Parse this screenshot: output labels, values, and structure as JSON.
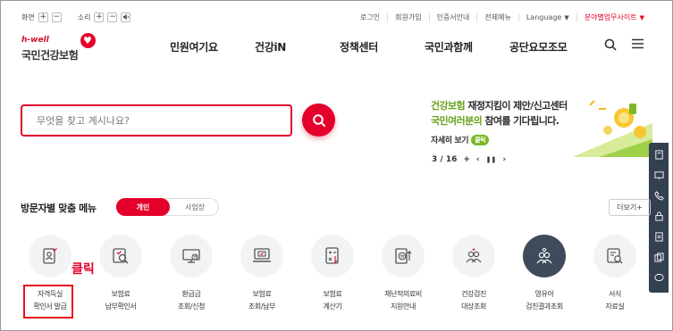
{
  "utility": {
    "screen_label": "화면",
    "sound_label": "소리",
    "plus": "+",
    "minus": "−",
    "links": [
      "로그인",
      "회원가입",
      "인증서안내",
      "전체메뉴"
    ],
    "language": "Language",
    "subsite": "분야별업무사이트"
  },
  "logo": {
    "sub": "h-well",
    "main": "국민건강보험"
  },
  "gnb": [
    "민원여기요",
    "건강iN",
    "정책센터",
    "국민과함께",
    "공단요모조모"
  ],
  "search": {
    "placeholder": "무엇을 찾고 계시나요?",
    "value": ""
  },
  "banner": {
    "line1_green": "건강보험",
    "line1_dark": "재정지킴이 제안/신고센터",
    "line2_green": "국민여러분의",
    "line2_dark": "참여를 기다립니다.",
    "more": "자세히 보기",
    "more_badge": "클릭",
    "pager": "3 / 16",
    "plus": "+",
    "prev": "‹",
    "pause": "❚❚",
    "next": "›"
  },
  "section": {
    "title": "방문자별 맞춤 메뉴",
    "tab_on": "개인",
    "tab_off": "사업장",
    "more": "더보기+"
  },
  "menu": [
    {
      "label": "자격득실\n확인서 발급",
      "icon": "id-card-icon"
    },
    {
      "label": "보험료\n납부확인서",
      "icon": "document-search-icon"
    },
    {
      "label": "환급금\n조회/신청",
      "icon": "monitor-won-icon"
    },
    {
      "label": "보험료\n조회/납부",
      "icon": "laptop-card-icon"
    },
    {
      "label": "보험료\n계산기",
      "icon": "calculator-icon"
    },
    {
      "label": "재난적의료비\n지원안내",
      "icon": "coin-arrow-icon"
    },
    {
      "label": "건강검진\n대상조회",
      "icon": "people-heart-icon"
    },
    {
      "label": "영유아\n검진결과조회",
      "icon": "children-heart-icon"
    },
    {
      "label": "서식\n자료실",
      "icon": "form-search-icon"
    }
  ],
  "annotation": {
    "text": "클릭"
  },
  "colors": {
    "brand_red": "#e4002b",
    "banner_green": "#6aa21e",
    "sidebar_navy": "#33404f"
  }
}
